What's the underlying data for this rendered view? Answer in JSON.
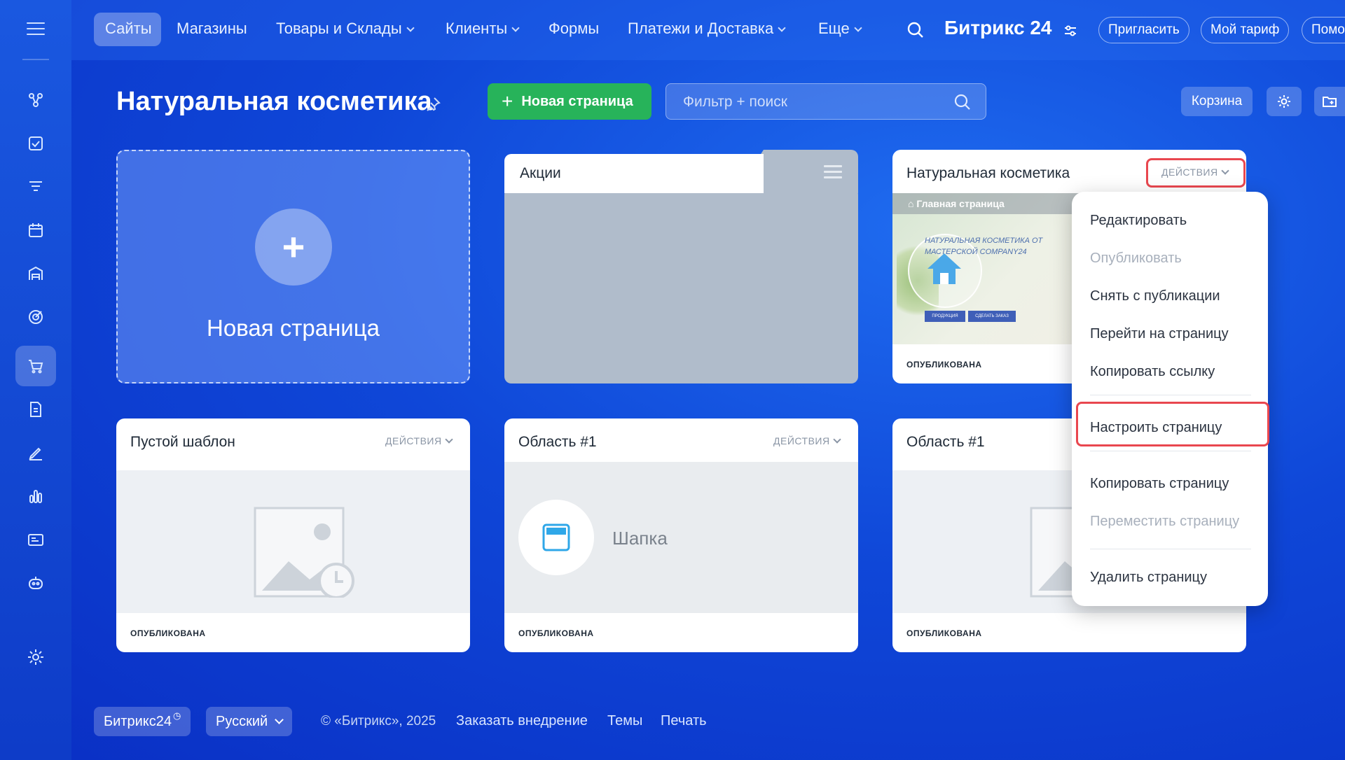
{
  "nav": {
    "items": [
      {
        "label": "Сайты",
        "dropdown": false
      },
      {
        "label": "Магазины",
        "dropdown": false
      },
      {
        "label": "Товары и Склады",
        "dropdown": true
      },
      {
        "label": "Клиенты",
        "dropdown": true
      },
      {
        "label": "Формы",
        "dropdown": false
      },
      {
        "label": "Платежи и Доставка",
        "dropdown": true
      },
      {
        "label": "Еще",
        "dropdown": true
      }
    ],
    "brand": "Битрикс 24",
    "invite": "Пригласить",
    "tariff": "Мой тариф",
    "help": "Помо"
  },
  "header": {
    "title": "Натуральная косметика",
    "new_page_button": "Новая страница",
    "search_placeholder": "Фильтр + поиск",
    "cart_button": "Корзина"
  },
  "cards": {
    "new_page": "Новая страница",
    "folder_title": "Акции",
    "site_card": {
      "title": "Натуральная косметика",
      "actions": "ДЕЙСТВИЯ",
      "preview_home": "Главная страница",
      "preview_heading": "НАТУРАЛЬНАЯ КОСМЕТИКА ОТ МАСТЕРСКОЙ COMPANY24",
      "preview_btn1": "ПРОДУКЦИЯ",
      "preview_btn2": "СДЕЛАТЬ ЗАКАЗ",
      "status": "ОПУБЛИКОВАНА"
    },
    "empty_template": {
      "title": "Пустой шаблон",
      "actions": "ДЕЙСТВИЯ",
      "status": "ОПУБЛИКОВАНА"
    },
    "area1": {
      "title": "Область #1",
      "actions": "ДЕЙСТВИЯ",
      "preview_label": "Шапка",
      "status": "ОПУБЛИКОВАНА"
    },
    "area2": {
      "title": "Область #1",
      "status": "ОПУБЛИКОВАНА"
    }
  },
  "dropdown": {
    "edit": "Редактировать",
    "publish": "Опубликовать",
    "unpublish": "Снять с публикации",
    "goto": "Перейти на страницу",
    "copy_link": "Копировать ссылку",
    "configure": "Настроить страницу",
    "copy_page": "Копировать страницу",
    "move_page": "Переместить страницу",
    "delete_page": "Удалить страницу"
  },
  "footer": {
    "brand": "Битрикс24",
    "language": "Русский",
    "copyright": "© «Битрикс», 2025",
    "order": "Заказать внедрение",
    "themes": "Темы",
    "print": "Печать"
  },
  "colors": {
    "accent_green": "#27b35a",
    "highlight_red": "#e9474f",
    "background_blue": "#0f47d8"
  }
}
